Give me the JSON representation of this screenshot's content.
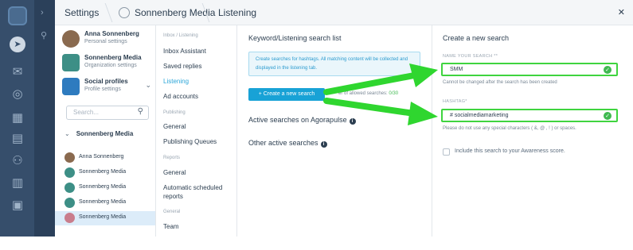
{
  "header": {
    "crumbs": [
      "Settings",
      "Sonnenberg Media",
      "Listening"
    ],
    "close_icon": "close-icon"
  },
  "accounts": {
    "user": {
      "name": "Anna Sonnenberg",
      "sub": "Personal settings"
    },
    "org": {
      "name": "Sonnenberg Media",
      "sub": "Organization settings"
    },
    "profiles": {
      "name": "Social profiles",
      "sub": "Profile settings"
    },
    "search_placeholder": "Search...",
    "group": "Sonnenberg Media",
    "items": [
      "Anna Sonnenberg",
      "Sonnenberg Media",
      "Sonnenberg Media",
      "Sonnenberg Media",
      "Sonnenberg Media"
    ]
  },
  "nav": {
    "breadcrumb": "Inbox / Listening",
    "inbox_items": [
      "Inbox Assistant",
      "Saved replies",
      "Listening",
      "Ad accounts"
    ],
    "publishing_label": "Publishing",
    "publishing_items": [
      "General",
      "Publishing Queues"
    ],
    "reports_label": "Reports",
    "reports_items": [
      "General",
      "Automatic scheduled reports"
    ],
    "general_label": "General",
    "general_items": [
      "Team"
    ]
  },
  "middle": {
    "title": "Keyword/Listening search list",
    "info": "Create searches for hashtags. All matching content will be collected and displayed in the listening tab.",
    "create_button": "+ Create a new search",
    "quota_label": "er of allowed searches:",
    "quota_value": "0/30",
    "active_label": "Active searches on Agorapulse",
    "other_label": "Other active searches"
  },
  "right": {
    "title": "Create a new search",
    "name_label": "NAME YOUR SEARCH **",
    "name_value": "SMM",
    "name_hint": "Cannot be changed after the search has been created",
    "hashtag_label": "HASHTAG*",
    "hashtag_value": "# socialmediamarketing",
    "hashtag_hint": "Please do not use any special characters ( &, @ , ! ) or spaces.",
    "checkbox_label": "Include this search to your Awareness score."
  },
  "colors": {
    "rail": "#364e6b",
    "accent": "#18a2d6",
    "success": "#3fb950",
    "arrow": "#2fd62f"
  }
}
